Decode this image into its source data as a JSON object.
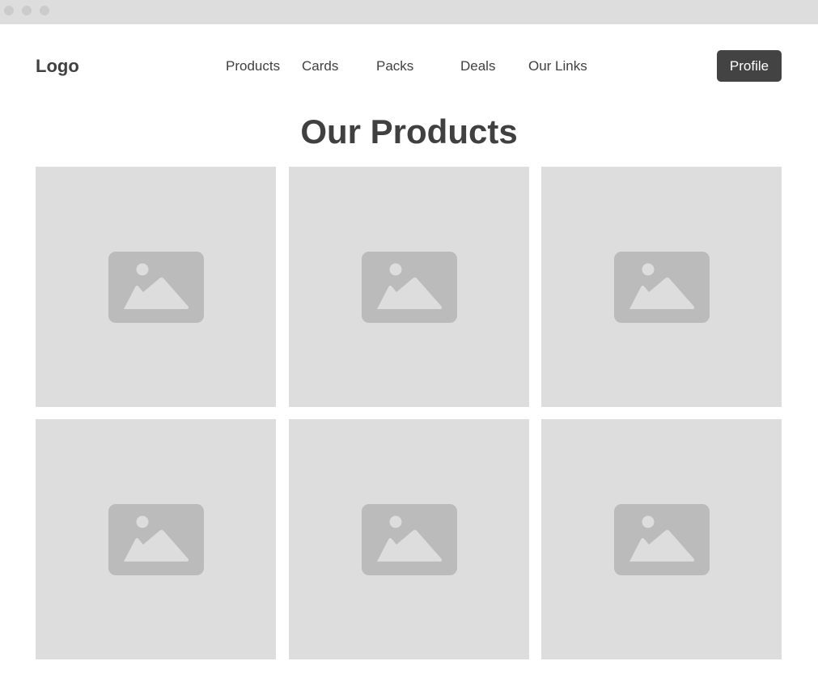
{
  "header": {
    "logo": "Logo",
    "nav": [
      "Products",
      "Cards",
      "Packs",
      "Deals",
      "Our Links"
    ],
    "profile_label": "Profile"
  },
  "main": {
    "title": "Our Products",
    "products": [
      {
        "icon": "image-placeholder-icon"
      },
      {
        "icon": "image-placeholder-icon"
      },
      {
        "icon": "image-placeholder-icon"
      },
      {
        "icon": "image-placeholder-icon"
      },
      {
        "icon": "image-placeholder-icon"
      },
      {
        "icon": "image-placeholder-icon"
      }
    ]
  },
  "colors": {
    "text": "#404040",
    "button": "#434343",
    "placeholder_bg": "#dddddd",
    "placeholder_icon": "#bbbbbb"
  }
}
